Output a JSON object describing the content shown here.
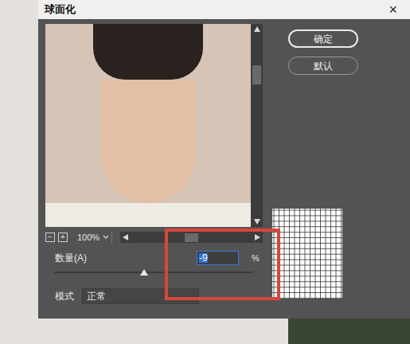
{
  "window": {
    "title": "球面化",
    "close": "×"
  },
  "buttons": [
    {
      "label": "确定",
      "default": true
    },
    {
      "label": "默认",
      "default": false
    }
  ],
  "preview": {
    "zoom": "100%",
    "zoom_out": "−",
    "zoom_in": "+"
  },
  "amount": {
    "label": "数量(A)",
    "value": "-9",
    "unit": "%",
    "level": 0.45,
    "selected": true
  },
  "mode": {
    "label": "模式",
    "value": "正常"
  },
  "annotation": {
    "color": "#d9463a"
  }
}
